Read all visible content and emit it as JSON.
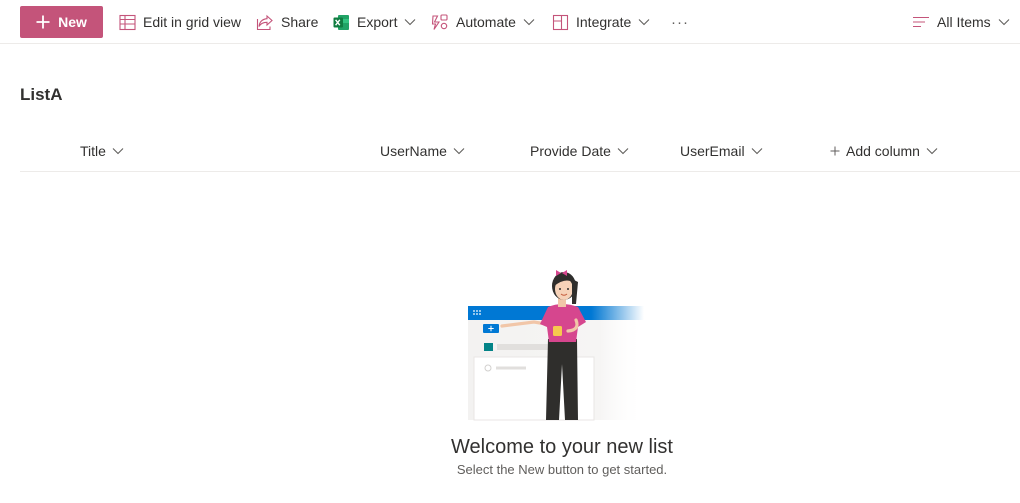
{
  "toolbar": {
    "new_label": "New",
    "edit_grid_label": "Edit in grid view",
    "share_label": "Share",
    "export_label": "Export",
    "automate_label": "Automate",
    "integrate_label": "Integrate",
    "more_label": "···",
    "view_label": "All Items"
  },
  "list": {
    "title": "ListA",
    "columns": [
      {
        "label": "Title"
      },
      {
        "label": "UserName"
      },
      {
        "label": "Provide Date"
      },
      {
        "label": "UserEmail"
      }
    ],
    "add_column_label": "Add column"
  },
  "empty_state": {
    "heading": "Welcome to your new list",
    "subtext": "Select the New button to get started."
  },
  "colors": {
    "brand": "#c4547a",
    "excel_green": "#107c41",
    "link_blue": "#0078d4"
  },
  "icons": {
    "new": "plus-icon",
    "edit_grid": "grid-icon",
    "share": "share-icon",
    "export": "excel-icon",
    "automate": "flow-icon",
    "integrate": "integrate-icon",
    "view": "lines-icon"
  }
}
